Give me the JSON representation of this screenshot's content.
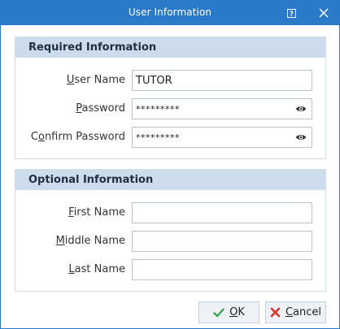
{
  "window": {
    "title": "User Information",
    "help_glyph": "?",
    "close_glyph": "✕"
  },
  "required": {
    "header": "Required Information",
    "user_name": {
      "label_hotkey": "U",
      "label_rest": "ser Name",
      "value": "TUTOR"
    },
    "password": {
      "label_hotkey": "P",
      "label_rest": "assword",
      "value": "*********"
    },
    "confirm_password": {
      "label_pre": "C",
      "label_hotkey": "o",
      "label_rest": "nfirm Password",
      "value": "*********"
    }
  },
  "optional": {
    "header": "Optional Information",
    "first_name": {
      "label_hotkey": "F",
      "label_rest": "irst Name",
      "value": ""
    },
    "middle_name": {
      "label_hotkey": "M",
      "label_rest": "iddle Name",
      "value": ""
    },
    "last_name": {
      "label_hotkey": "L",
      "label_rest": "ast Name",
      "value": ""
    }
  },
  "buttons": {
    "ok": {
      "hotkey": "O",
      "rest": "K"
    },
    "cancel": {
      "hotkey": "C",
      "rest": "ancel"
    }
  },
  "colors": {
    "titlebar": "#2b79c9",
    "group_header": "#ccdcec",
    "ok_check": "#3aa655",
    "cancel_x": "#d6342c"
  },
  "icons": {
    "eye": "eye-icon",
    "ok": "check-icon",
    "cancel": "x-icon"
  }
}
